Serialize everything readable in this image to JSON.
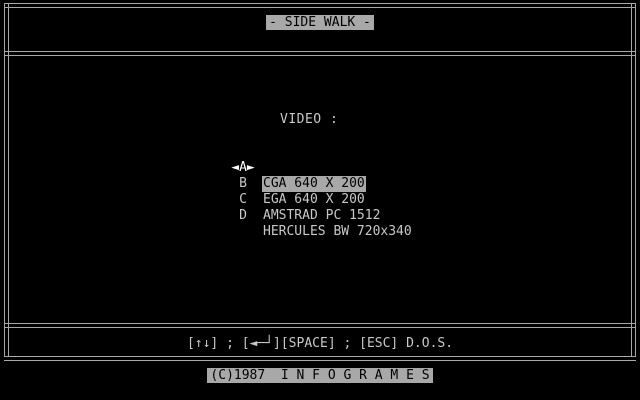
{
  "title": "- SIDE WALK -",
  "video_label": "VIDEO :",
  "options": [
    {
      "key": "◄A►",
      "label": "CGA 640 X 200",
      "selected": true
    },
    {
      "key": "B",
      "label": "EGA 640 X 200",
      "selected": false
    },
    {
      "key": "C",
      "label": "AMSTRAD PC 1512",
      "selected": false
    },
    {
      "key": "D",
      "label": "HERCULES BW 720x340",
      "selected": false
    }
  ],
  "keys_hint": "[↑↓] ; [◄─┘][SPACE] ; [ESC] D.O.S.",
  "footer": "(C)1987  I N F O G R A M E S"
}
